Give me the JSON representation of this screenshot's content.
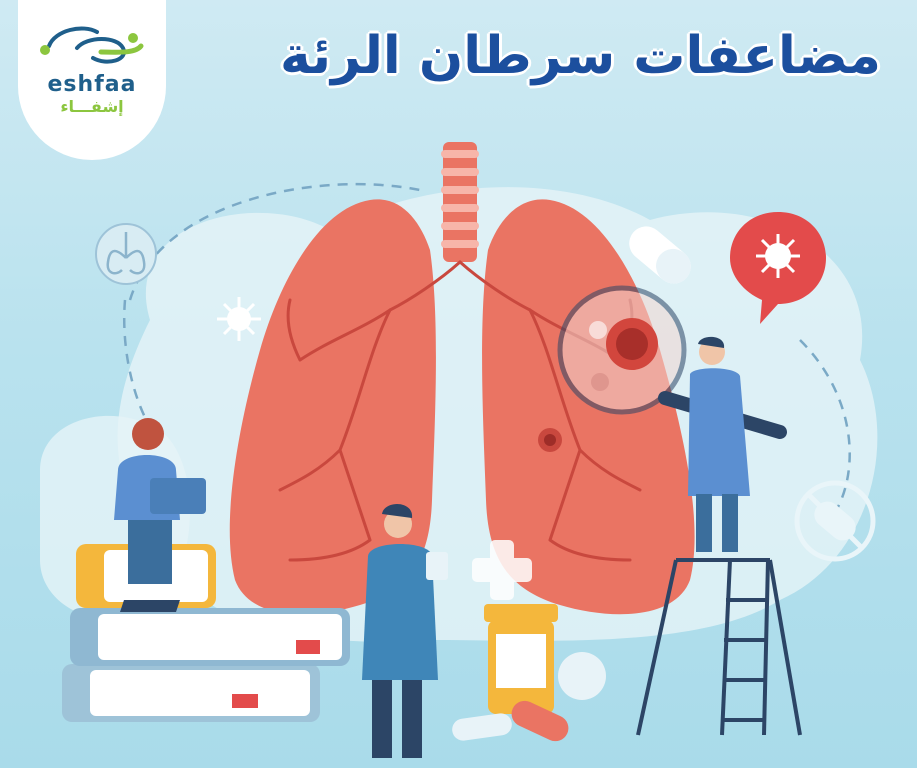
{
  "logo": {
    "english": "eshfaa",
    "arabic": "إشفـــاء",
    "accent_color": "#8cc63f",
    "brand_color": "#1f5f8b"
  },
  "title": "مضاعفات سرطان الرئة",
  "colors": {
    "lung": "#ea7463",
    "lung_dark": "#c9483e",
    "coat": "#5b8fd1",
    "background": "#b9e2ee",
    "alert": "#e34b4b"
  },
  "illustration": {
    "icons": [
      "lungs-icon",
      "virus-icon",
      "pill-icon",
      "virus-alert-icon",
      "magnifying-glass-icon",
      "no-pill-icon",
      "cross-icon"
    ]
  }
}
